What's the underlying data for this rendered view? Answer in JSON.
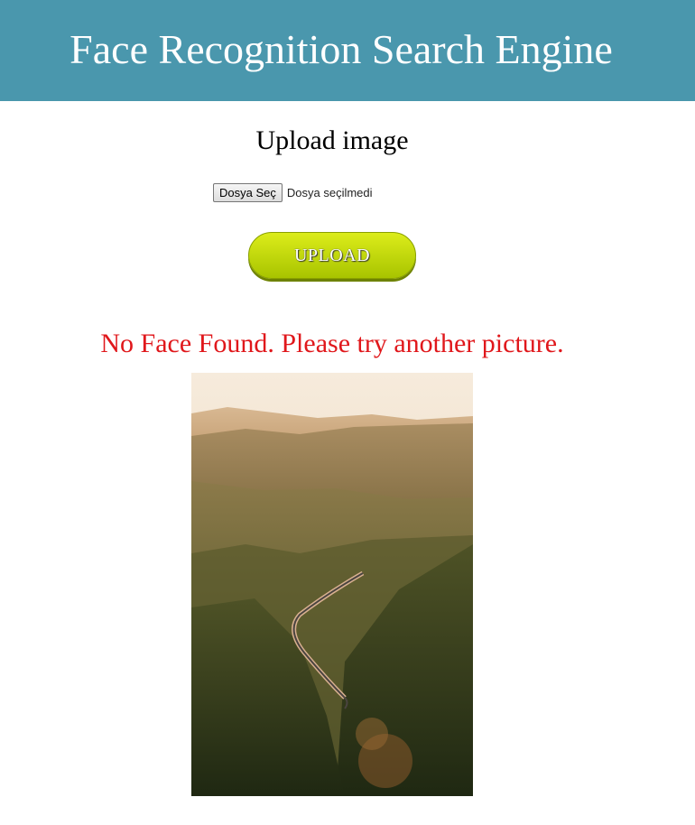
{
  "header": {
    "title": "Face Recognition Search Engine"
  },
  "upload": {
    "heading": "Upload image",
    "file_button_label": "Dosya Seç",
    "file_status": "Dosya seçilmedi",
    "upload_button_label": "UPLOAD"
  },
  "result": {
    "message": "No Face Found. Please try another picture.",
    "message_color": "#e0171b"
  },
  "colors": {
    "header_bg": "#4a97ad",
    "button_accent": "#c8dc0a"
  }
}
